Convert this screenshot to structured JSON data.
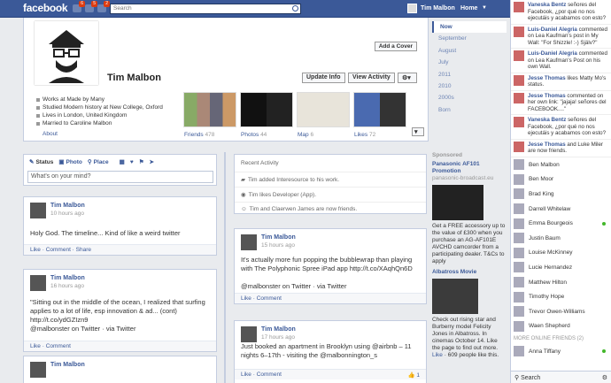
{
  "topbar": {
    "logo": "facebook",
    "notif_counts": [
      "6",
      "5",
      "2"
    ],
    "search_placeholder": "Search",
    "user": "Tim Malbon",
    "home": "Home"
  },
  "profile": {
    "add_cover": "Add a Cover",
    "name": "Tim Malbon",
    "update_info": "Update Info",
    "view_activity": "View Activity",
    "about": [
      "Works at Made by Many",
      "Studied Modern history at New College, Oxford",
      "Lives in London, United Kingdom",
      "Married to Caroline Malbon"
    ],
    "about_link": "About",
    "tiles": [
      {
        "label": "Friends",
        "count": "478"
      },
      {
        "label": "Photos",
        "count": "44"
      },
      {
        "label": "Map",
        "count": "6"
      },
      {
        "label": "Likes",
        "count": "72"
      }
    ]
  },
  "timeline_nav": [
    "Now",
    "September",
    "August",
    "July",
    "2011",
    "2010",
    "2000s",
    "Born"
  ],
  "status": {
    "tabs": [
      "Status",
      "Photo",
      "Place"
    ],
    "placeholder": "What's on your mind?"
  },
  "recent": {
    "title": "Recent Activity",
    "rows": [
      "Tim added Interesource to his work.",
      "Tim likes Developer (App).",
      "Tim and Claerwen James are now friends."
    ]
  },
  "posts": [
    {
      "name": "Tim Malbon",
      "time": "10 hours ago",
      "text": "Holy God. The timeline... Kind of like a weird twitter",
      "foot": "Like · Comment · Share"
    },
    {
      "name": "Tim Malbon",
      "time": "16 hours ago",
      "text": "\"Sitting out in the middle of the ocean, I realized that surfing applies to a lot of life, esp innovation & ad... (cont) http://t.co/ydGZIzn9",
      "via": "@malbonster on Twitter · via Twitter",
      "foot": "Like · Comment"
    },
    {
      "name": "Tim Malbon",
      "time": "15 hours ago",
      "text": "It's actually more fun popping the bubblewrap than playing with The Polyphonic Spree iPad app http://t.co/XAqhQn6D",
      "via": "@malbonster on Twitter · via Twitter",
      "foot": "Like · Comment"
    },
    {
      "name": "Tim Malbon",
      "time": "17 hours ago",
      "text": "Just booked an apartment in Brooklyn using @airbnb – 11 nights 6–17th - visiting the @malbonnington_s",
      "foot": "Like · Comment",
      "likes": "1"
    },
    {
      "name": "Tim Malbon",
      "time": "",
      "text": "",
      "foot": ""
    }
  ],
  "ads": {
    "header": "Sponsored",
    "a1_title": "Panasonic AF101 Promotion",
    "a1_url": "panasonic-broadcast.eu",
    "a1_body": "Get a FREE accessory up to the value of £300 when you purchase an AG-AF101E AVCHD camcorder from a participating dealer. T&Cs to apply",
    "a2_title": "Albatross Movie",
    "a2_body": "Check out rising star and Burberry model Felicity Jones in Albatross. In cinemas October 14. Like the page to find out more.",
    "a2_like": "Like",
    "a2_like_rest": " · 609 people like this."
  },
  "ticker": [
    {
      "name": "Vaneska Bentz",
      "text": "señores del Facebook, ¿por qué no nos ejecutáis y acabamos con esto?"
    },
    {
      "name": "Luis-Daniel Alegria",
      "text": "commented on Lea Kaufman's post in My Wall: \"For Shizzle! :-) Själv?\""
    },
    {
      "name": "Luis-Daniel Alegria",
      "text": "commented on Lea Kaufman's Post on his own Wall."
    },
    {
      "name": "Jesse Thomas",
      "text": "likes Matty Mo's status."
    },
    {
      "name": "Jesse Thomas",
      "text": "commented on her own link: \"jajaja! señores del FACEBOOK....\""
    },
    {
      "name": "Vaneska Bentz",
      "text": "señores del Facebook, ¿por qué no nos ejecutáis y acabamos con esto?"
    },
    {
      "name": "Jesse Thomas",
      "text": "and Luke Miler are now friends."
    }
  ],
  "chat": [
    "Ben Malbon",
    "Ben Moor",
    "Brad King",
    "Darrell Whitelaw",
    "Emma Bourgeois",
    "Justin Baum",
    "Louise McKinney",
    "Lucie Hernandez",
    "Matthew Hilton",
    "Timothy Hope",
    "Trevor Owen-Williams",
    "Waen Shepherd"
  ],
  "chat_more": "MORE ONLINE FRIENDS (2)",
  "chat_more_list": [
    "Anna Tiffany"
  ],
  "chat_search": "Search"
}
